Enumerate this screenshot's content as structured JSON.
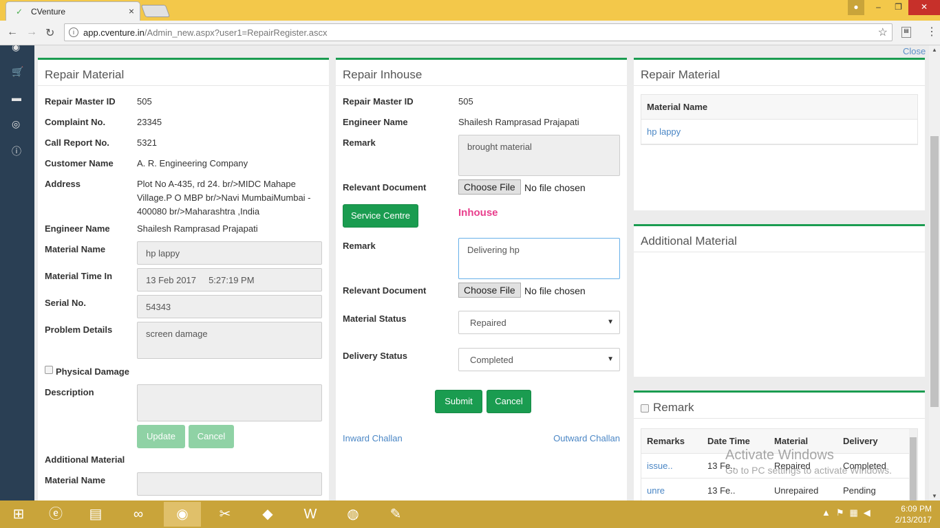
{
  "browser": {
    "tab_title": "CVenture",
    "tab_close": "×",
    "url_host": "app.cventure.in",
    "url_path": "/Admin_new.aspx?user1=RepairRegister.ascx"
  },
  "page": {
    "close_label": "Close"
  },
  "left_panel": {
    "title": "Repair Material",
    "fields": {
      "repair_master_id_label": "Repair Master ID",
      "repair_master_id": "505",
      "complaint_no_label": "Complaint No.",
      "complaint_no": "23345",
      "call_report_no_label": "Call Report No.",
      "call_report_no": "5321",
      "customer_name_label": "Customer Name",
      "customer_name": "A. R. Engineering Company",
      "address_label": "Address",
      "address_line1": "Plot No A-435, rd 24. br/>MIDC Mahape",
      "address_line2": "Village.P O MBP br/>Navi MumbaiMumbai -",
      "address_line3": "400080 br/>Maharashtra ,India",
      "engineer_name_label": "Engineer Name",
      "engineer_name": "Shailesh Ramprasad Prajapati",
      "material_name_label": "Material Name",
      "material_name": "hp lappy",
      "material_time_in_label": "Material Time In",
      "material_time_in": "13 Feb 2017     5:27:19 PM",
      "serial_no_label": "Serial No.",
      "serial_no": "54343",
      "problem_details_label": "Problem Details",
      "problem_details": "screen damage",
      "physical_damage_label": "Physical Damage",
      "description_label": "Description",
      "update_label": "Update",
      "cancel_label": "Cancel",
      "additional_material_label": "Additional Material",
      "material_name2_label": "Material Name"
    }
  },
  "middle_panel": {
    "title": "Repair Inhouse",
    "repair_master_id_label": "Repair Master ID",
    "repair_master_id": "505",
    "engineer_name_label": "Engineer Name",
    "engineer_name": "Shailesh Ramprasad Prajapati",
    "remark_label": "Remark",
    "remark_value": "brought material",
    "relevant_document_label": "Relevant Document",
    "choose_file": "Choose File",
    "no_file": "No file chosen",
    "service_centre_label": "Service Centre",
    "inhouse_label": "Inhouse",
    "remark2_label": "Remark",
    "remark2_value": "Delivering hp",
    "relevant_document2_label": "Relevant Document",
    "material_status_label": "Material Status",
    "material_status": "Repaired",
    "delivery_status_label": "Delivery Status",
    "delivery_status": "Completed",
    "submit_label": "Submit",
    "cancel_label": "Cancel",
    "inward_challan": "Inward Challan",
    "outward_challan": "Outward Challan"
  },
  "right_panel": {
    "repair_material_title": "Repair Material",
    "material_table_header": "Material Name",
    "material_table_row": "hp lappy",
    "additional_material_title": "Additional Material",
    "remark_title": "Remark",
    "remarks_table": {
      "headers": [
        "Remarks",
        "Date Time",
        "Material",
        "Delivery"
      ],
      "rows": [
        [
          "issue..",
          "13 Fe..",
          "Repaired",
          "Completed"
        ],
        [
          "unre",
          "13 Fe..",
          "Unrepaired",
          "Pending"
        ]
      ]
    }
  },
  "watermark": {
    "line1": "Activate Windows",
    "line2": "Go to PC settings to activate Windows."
  },
  "taskbar": {
    "time": "6:09 PM",
    "date": "2/13/2017"
  },
  "colors": {
    "accent_green": "#1a9c50",
    "inhouse_pink": "#e83e8c",
    "link_blue": "#4a86c5",
    "sidebar": "#2a3f54",
    "taskbar": "#c9a43a"
  }
}
